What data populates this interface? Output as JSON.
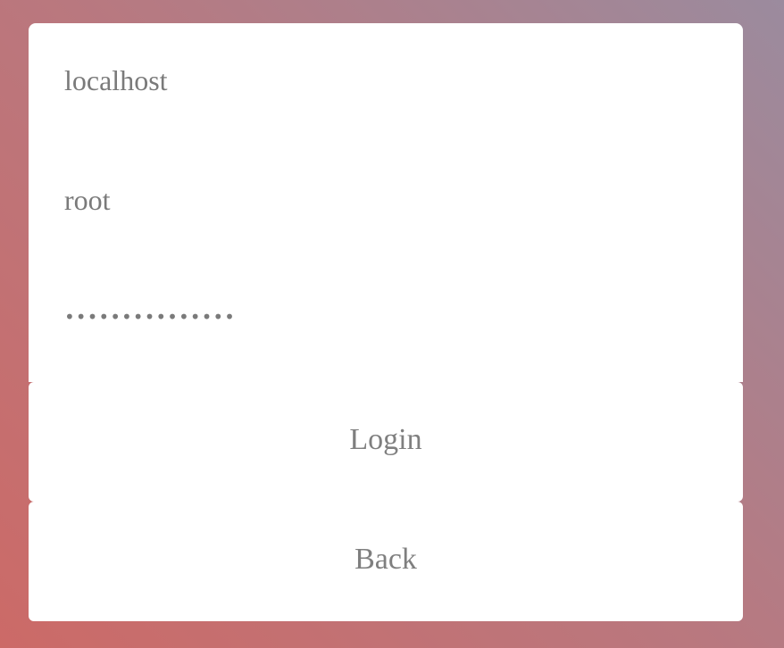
{
  "form": {
    "host": {
      "value": "localhost"
    },
    "user": {
      "value": "root"
    },
    "password": {
      "value": "•••••••••••••••"
    },
    "login_label": "Login",
    "back_label": "Back"
  },
  "colors": {
    "background_start": "#cc6a67",
    "background_end": "#9b8b9e",
    "panel": "#ffffff",
    "text": "#7a7a7a"
  }
}
